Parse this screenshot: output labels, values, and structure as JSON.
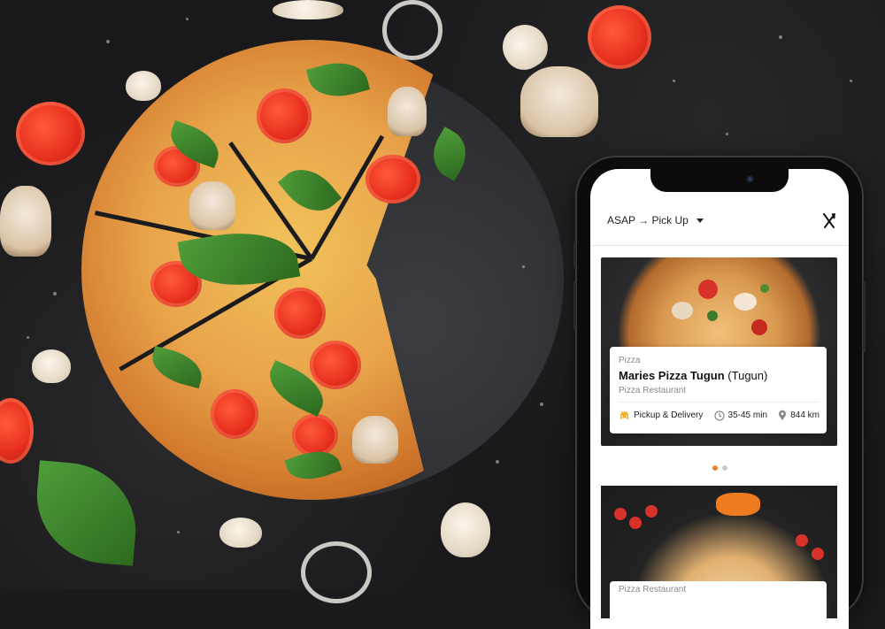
{
  "app": {
    "header": {
      "mode_label": "ASAP → Pick Up",
      "utensils_icon": "fork-knife-icon"
    },
    "listings": [
      {
        "category": "Pizza",
        "name_bold": "Maries Pizza Tugun",
        "name_suffix": "(Tugun)",
        "type": "Pizza Restaurant",
        "service": "Pickup & Delivery",
        "time": "35-45 min",
        "distance": "844 km"
      },
      {
        "category": "Pizza Restaurant"
      }
    ],
    "carousel": {
      "count": 2,
      "active": 0
    },
    "colors": {
      "accent": "#f0812e",
      "delivery_icon": "#f2b12a"
    }
  }
}
